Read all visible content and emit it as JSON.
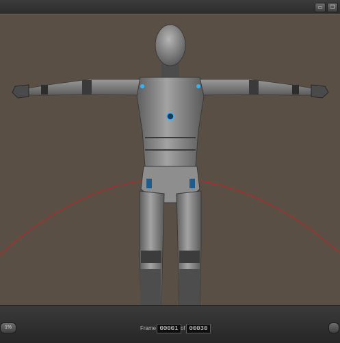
{
  "toolbar": {
    "icons": [
      "window-icon",
      "restore-icon"
    ]
  },
  "viewport": {
    "background": "#5a4f45",
    "figure_color": "#8a8a8a",
    "accent_light": "#2fb6ff",
    "arc_color": "#b22a2a"
  },
  "timeline": {
    "frame_label": "Frame",
    "current_frame": "00001",
    "of_label": "of",
    "total_frames": "00030",
    "left_button_label": "1%"
  }
}
